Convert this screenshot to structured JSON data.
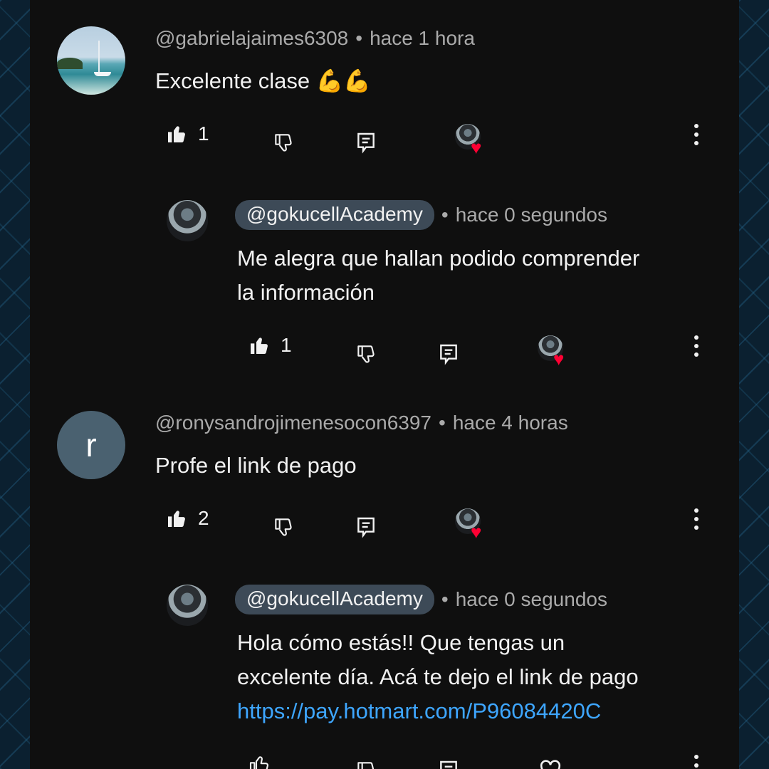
{
  "comments": [
    {
      "handle": "@gabrielajaimes6308",
      "time": "hace 1 hora",
      "text": "Excelente clase 💪💪",
      "likes": "1",
      "avatar": "sea-photo-avatar"
    },
    {
      "handle": "@gokucellAcademy",
      "time": "hace 0 segundos",
      "text_line1": "Me alegra que hallan podido comprender",
      "text_line2": "la información",
      "likes": "1",
      "avatar": "channel-avatar"
    },
    {
      "handle": "@ronysandrojimenesocon6397",
      "time": "hace 4 horas",
      "text": "Profe el link de pago",
      "likes": "2",
      "avatar_letter": "r"
    },
    {
      "handle": "@gokucellAcademy",
      "time": "hace 0 segundos",
      "text_line1": "Hola cómo estás!! Que tengas un",
      "text_line2": "excelente día. Acá te dejo el link de pago",
      "link": "https://pay.hotmart.com/P96084420C",
      "avatar": "channel-avatar"
    }
  ],
  "separator": "•",
  "icons": {
    "like": "thumbs-up-filled-icon",
    "dislike": "thumbs-down-icon",
    "reply": "reply-icon",
    "heart": "creator-heart-icon",
    "more": "more-vertical-icon"
  },
  "colors": {
    "background": "#0f0f0f",
    "text": "#f1f1f1",
    "secondary": "#aaaaaa",
    "link": "#3ea6ff",
    "heart": "#ff0033",
    "handle_pill": "#3d4a57"
  }
}
